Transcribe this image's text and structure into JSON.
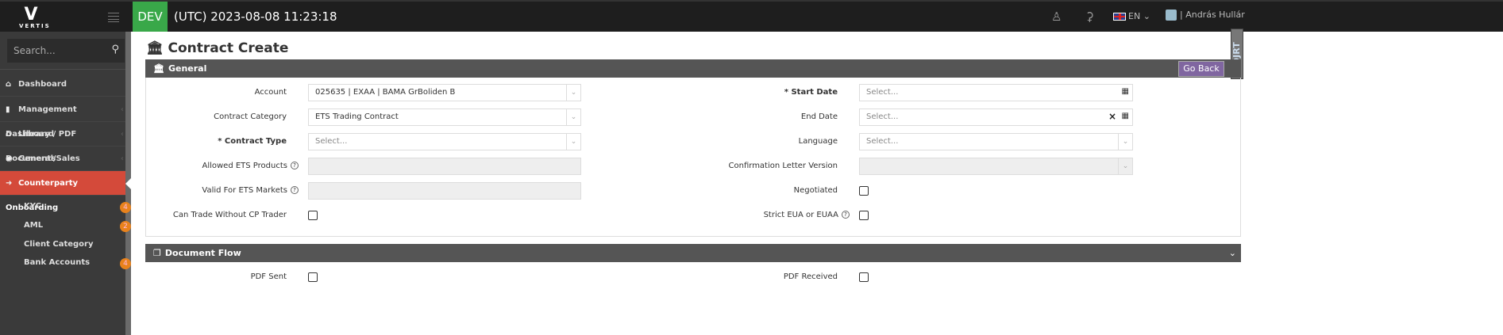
{
  "brand": {
    "logo_text": "VERTIS"
  },
  "topbar": {
    "env": "DEV",
    "clock": "(UTC) 2023-08-08 11:23:18",
    "language": "EN",
    "user_name": "András Hullár",
    "icons": [
      "user-icon",
      "bell-icon",
      "uk-flag-icon",
      "chevron-down-icon"
    ]
  },
  "sidebar": {
    "search_placeholder": "Search...",
    "items": [
      {
        "label": "Dashboard",
        "icon": "home-icon"
      },
      {
        "label": "Management Dashboard",
        "icon": "book-icon"
      },
      {
        "label": "Library / PDF Documents",
        "icon": "bank-icon"
      },
      {
        "label": "General/Sales",
        "icon": "globe-icon"
      },
      {
        "label": "Counterparty Onboarding",
        "icon": "sign-in-icon",
        "active": true
      }
    ],
    "subitems": [
      {
        "label": "KYC",
        "badge": "4"
      },
      {
        "label": "AML",
        "badge": "2"
      },
      {
        "label": "Client Category"
      },
      {
        "label": "Bank Accounts",
        "badge": "4"
      }
    ]
  },
  "page": {
    "title": "Contract Create",
    "side_tab": "DJRT"
  },
  "general": {
    "title": "General",
    "go_back": "Go Back",
    "left": [
      {
        "label": "Account",
        "value": "025635 | EXAA | BAMA GrBoliden B"
      },
      {
        "label": "Contract Category",
        "value": "ETS Trading Contract"
      },
      {
        "label": "* Contract Type",
        "placeholder": "Select...",
        "required": true
      },
      {
        "label": "Allowed ETS Products",
        "value": ""
      },
      {
        "label": "Valid For ETS Markets",
        "value": ""
      },
      {
        "label": "Can Trade Without CP Trader",
        "checked": false
      }
    ],
    "right": [
      {
        "label": "* Start Date",
        "placeholder": "Select...",
        "required": true
      },
      {
        "label": "End Date",
        "placeholder": "Select..."
      },
      {
        "label": "Language",
        "placeholder": "Select..."
      },
      {
        "label": "Confirmation Letter Version",
        "value": ""
      },
      {
        "label": "Negotiated",
        "checked": false
      },
      {
        "label": "Strict EUA or EUAA",
        "checked": false
      }
    ]
  },
  "document_flow": {
    "title": "Document Flow",
    "left_label": "PDF Sent",
    "right_label": "PDF Received"
  },
  "colors": {
    "dev": "#39a849",
    "active_nav": "#d44a3a",
    "badge": "#e8821c",
    "go_back": "#8066a0"
  }
}
